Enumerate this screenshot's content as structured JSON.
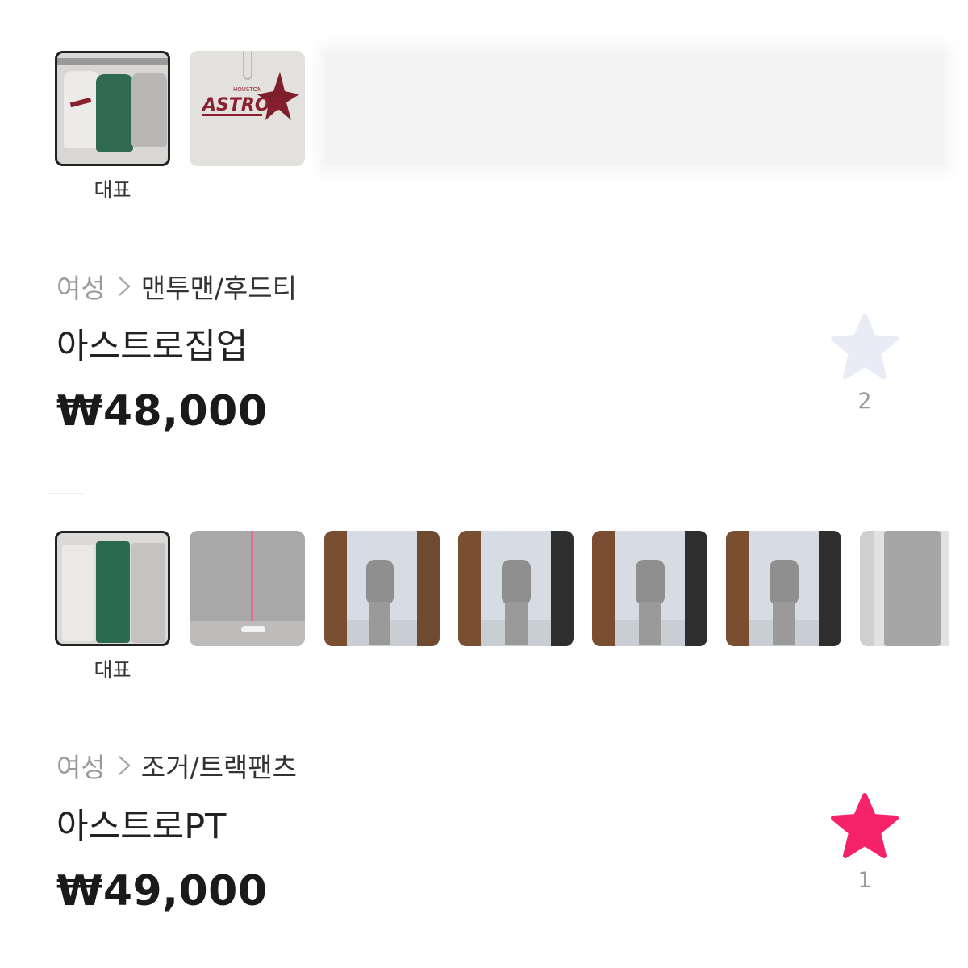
{
  "listings": [
    {
      "rep_label": "대표",
      "category": "여성",
      "separator": ">",
      "subcategory": "맨투맨/후드티",
      "title": "아스트로집업",
      "price": "₩48,000",
      "like_count": "2",
      "liked": false,
      "star_color": "#e9ecf6",
      "thumbnails": [
        "hoodie-lineup-photo",
        "astros-logo-closeup-photo"
      ],
      "thumb_logo_text": "ASTROS",
      "thumb_logo_subtext": "HOUSTON"
    },
    {
      "rep_label": "대표",
      "category": "여성",
      "separator": ">",
      "subcategory": "조거/트랙팬츠",
      "title": "아스트로PT",
      "price": "₩49,000",
      "like_count": "1",
      "liked": true,
      "star_color": "#f5226a",
      "thumbnails": [
        "pants-lineup-photo",
        "fabric-closeup-photo",
        "mirror-selfie-photo",
        "mirror-selfie-photo",
        "mirror-selfie-photo",
        "mirror-selfie-photo",
        "pants-detail-photo"
      ]
    }
  ],
  "icons": {
    "favorite": "star-icon",
    "separator": "chevron-right-icon"
  },
  "colors": {
    "text_primary": "#222222",
    "text_muted": "#9a9a9a",
    "liked_star": "#f5226a",
    "unliked_star": "#e9ecf6"
  }
}
